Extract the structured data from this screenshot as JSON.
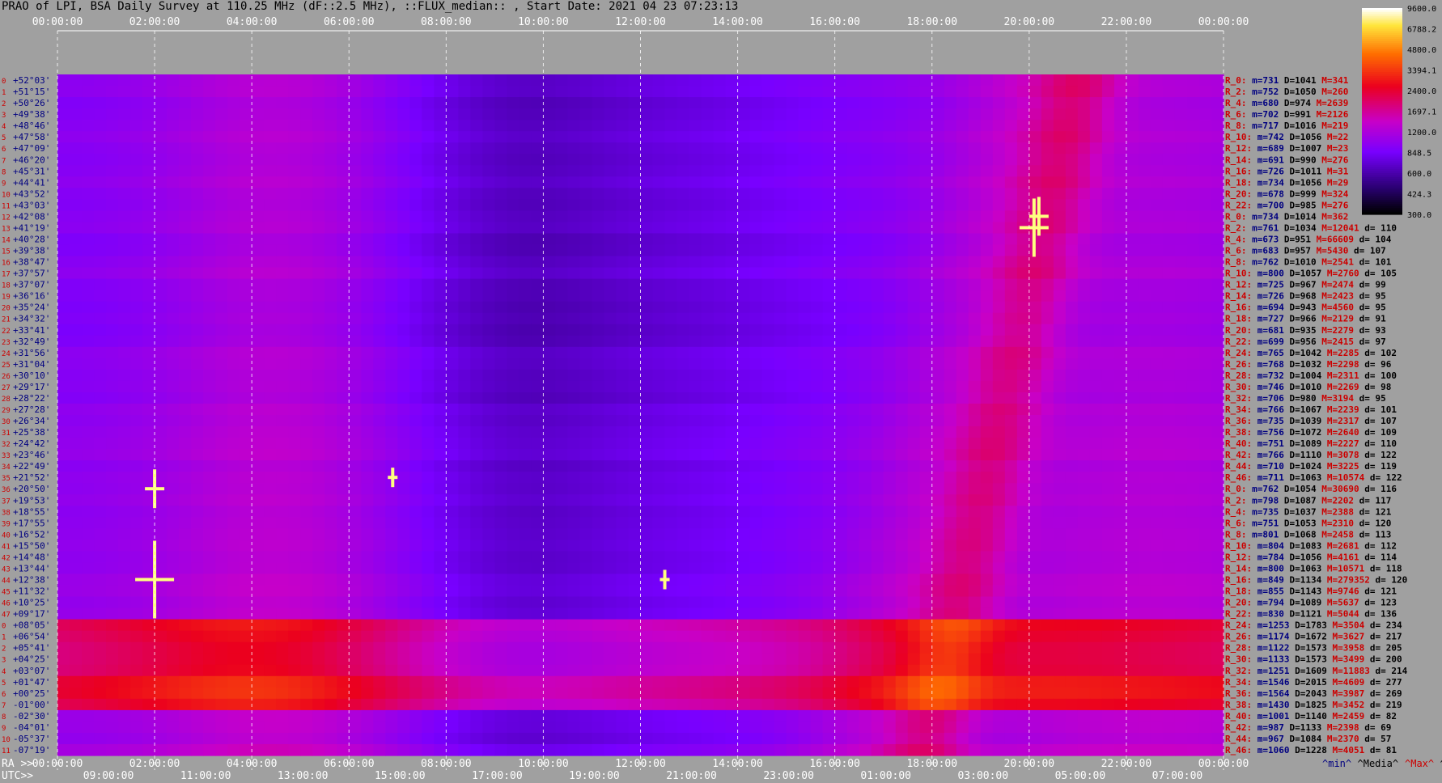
{
  "title": "PRAO of LPI, BSA Daily Survey at 110.25 MHz (dF::2.5 MHz), ::FLUX_median:: , Start Date: 2021 04 23 07:23:13",
  "colors": {
    "background": "#a0a0a0",
    "label_red": "#cc0000",
    "label_blue": "#000080",
    "axis_text": "#ffffff"
  },
  "chart_data": {
    "type": "heatmap",
    "title": "PRAO of LPI, BSA Daily Survey at 110.25 MHz (dF::2.5 MHz), ::FLUX_median:: , Start Date: 2021 04 23 07:23:13",
    "x_top_ticks": [
      "00:00:00",
      "02:00:00",
      "04:00:00",
      "06:00:00",
      "08:00:00",
      "10:00:00",
      "12:00:00",
      "14:00:00",
      "16:00:00",
      "18:00:00",
      "20:00:00",
      "22:00:00",
      "00:00:00"
    ],
    "x_ra_label": "RA >>",
    "x_ra_ticks": [
      "00:00:00",
      "02:00:00",
      "04:00:00",
      "06:00:00",
      "08:00:00",
      "10:00:00",
      "12:00:00",
      "14:00:00",
      "16:00:00",
      "18:00:00",
      "20:00:00",
      "22:00:00",
      "00:00:00"
    ],
    "x_utc_label": "UTC>>",
    "x_utc_ticks": [
      "09:00:00",
      "11:00:00",
      "13:00:00",
      "15:00:00",
      "17:00:00",
      "19:00:00",
      "21:00:00",
      "23:00:00",
      "01:00:00",
      "03:00:00",
      "05:00:00",
      "07:00:00"
    ],
    "y_labels": [
      "+52°03'",
      "+51°15'",
      "+50°26'",
      "+49°38'",
      "+48°46'",
      "+47°58'",
      "+47°09'",
      "+46°20'",
      "+45°31'",
      "+44°41'",
      "+43°52'",
      "+43°03'",
      "+42°08'",
      "+41°19'",
      "+40°28'",
      "+39°38'",
      "+38°47'",
      "+37°57'",
      "+37°07'",
      "+36°16'",
      "+35°24'",
      "+34°32'",
      "+33°41'",
      "+32°49'",
      "+31°56'",
      "+31°04'",
      "+30°10'",
      "+29°17'",
      "+28°22'",
      "+27°28'",
      "+26°34'",
      "+25°38'",
      "+24°42'",
      "+23°46'",
      "+22°49'",
      "+21°52'",
      "+20°50'",
      "+19°53'",
      "+18°55'",
      "+17°55'",
      "+16°52'",
      "+15°50'",
      "+14°48'",
      "+13°44'",
      "+12°38'",
      "+11°32'",
      "+10°25'",
      "+09°17'",
      "+08°05'",
      "+06°54'",
      "+05°41'",
      "+04°25'",
      "+03°07'",
      "+01°47'",
      "+00°25'",
      "-01°00'",
      "-02°30'",
      "-04°01'",
      "-05°37'",
      "-07°19'"
    ],
    "colorbar": {
      "ticks": [
        "9600.0",
        "6788.2",
        "4800.0",
        "3394.1",
        "2400.0",
        "1697.1",
        "1200.0",
        "848.5",
        "600.0",
        "424.3",
        "300.0"
      ],
      "range": [
        300,
        9600
      ],
      "scale": "log"
    },
    "beam_stats": [
      {
        "beam": "R_0:",
        "min": "m=731",
        "median": "D=1041",
        "max": "M=341",
        "devia": ""
      },
      {
        "beam": "R_2:",
        "min": "m=752",
        "median": "D=1050",
        "max": "M=260",
        "devia": ""
      },
      {
        "beam": "R_4:",
        "min": "m=680",
        "median": "D=974",
        "max": "M=2639",
        "devia": ""
      },
      {
        "beam": "R_6:",
        "min": "m=702",
        "median": "D=991",
        "max": "M=2126",
        "devia": ""
      },
      {
        "beam": "R_8:",
        "min": "m=717",
        "median": "D=1016",
        "max": "M=219",
        "devia": ""
      },
      {
        "beam": "R_10:",
        "min": "m=742",
        "median": "D=1056",
        "max": "M=22",
        "devia": ""
      },
      {
        "beam": "R_12:",
        "min": "m=689",
        "median": "D=1007",
        "max": "M=23",
        "devia": ""
      },
      {
        "beam": "R_14:",
        "min": "m=691",
        "median": "D=990",
        "max": "M=276",
        "devia": ""
      },
      {
        "beam": "R_16:",
        "min": "m=726",
        "median": "D=1011",
        "max": "M=31",
        "devia": ""
      },
      {
        "beam": "R_18:",
        "min": "m=734",
        "median": "D=1056",
        "max": "M=29",
        "devia": ""
      },
      {
        "beam": "R_20:",
        "min": "m=678",
        "median": "D=999",
        "max": "M=324",
        "devia": ""
      },
      {
        "beam": "R_22:",
        "min": "m=700",
        "median": "D=985",
        "max": "M=276",
        "devia": ""
      },
      {
        "beam": "R_0:",
        "min": "m=734",
        "median": "D=1014",
        "max": "M=362",
        "devia": ""
      },
      {
        "beam": "R_2:",
        "min": "m=761",
        "median": "D=1034",
        "max": "M=12041",
        "devia": "d= 110"
      },
      {
        "beam": "R_4:",
        "min": "m=673",
        "median": "D=951",
        "max": "M=66609",
        "devia": "d= 104"
      },
      {
        "beam": "R_6:",
        "min": "m=683",
        "median": "D=957",
        "max": "M=5430",
        "devia": "d= 107"
      },
      {
        "beam": "R_8:",
        "min": "m=762",
        "median": "D=1010",
        "max": "M=2541",
        "devia": "d= 101"
      },
      {
        "beam": "R_10:",
        "min": "m=800",
        "median": "D=1057",
        "max": "M=2760",
        "devia": "d= 105"
      },
      {
        "beam": "R_12:",
        "min": "m=725",
        "median": "D=967",
        "max": "M=2474",
        "devia": "d= 99"
      },
      {
        "beam": "R_14:",
        "min": "m=726",
        "median": "D=968",
        "max": "M=2423",
        "devia": "d= 95"
      },
      {
        "beam": "R_16:",
        "min": "m=694",
        "median": "D=943",
        "max": "M=4560",
        "devia": "d= 95"
      },
      {
        "beam": "R_18:",
        "min": "m=727",
        "median": "D=966",
        "max": "M=2129",
        "devia": "d= 91"
      },
      {
        "beam": "R_20:",
        "min": "m=681",
        "median": "D=935",
        "max": "M=2279",
        "devia": "d= 93"
      },
      {
        "beam": "R_22:",
        "min": "m=699",
        "median": "D=956",
        "max": "M=2415",
        "devia": "d= 97"
      },
      {
        "beam": "R_24:",
        "min": "m=765",
        "median": "D=1042",
        "max": "M=2285",
        "devia": "d= 102"
      },
      {
        "beam": "R_26:",
        "min": "m=768",
        "median": "D=1032",
        "max": "M=2298",
        "devia": "d= 96"
      },
      {
        "beam": "R_28:",
        "min": "m=732",
        "median": "D=1004",
        "max": "M=2311",
        "devia": "d= 100"
      },
      {
        "beam": "R_30:",
        "min": "m=746",
        "median": "D=1010",
        "max": "M=2269",
        "devia": "d= 98"
      },
      {
        "beam": "R_32:",
        "min": "m=706",
        "median": "D=980",
        "max": "M=3194",
        "devia": "d= 95"
      },
      {
        "beam": "R_34:",
        "min": "m=766",
        "median": "D=1067",
        "max": "M=2239",
        "devia": "d= 101"
      },
      {
        "beam": "R_36:",
        "min": "m=735",
        "median": "D=1039",
        "max": "M=2317",
        "devia": "d= 107"
      },
      {
        "beam": "R_38:",
        "min": "m=756",
        "median": "D=1072",
        "max": "M=2640",
        "devia": "d= 109"
      },
      {
        "beam": "R_40:",
        "min": "m=751",
        "median": "D=1089",
        "max": "M=2227",
        "devia": "d= 110"
      },
      {
        "beam": "R_42:",
        "min": "m=766",
        "median": "D=1110",
        "max": "M=3078",
        "devia": "d= 122"
      },
      {
        "beam": "R_44:",
        "min": "m=710",
        "median": "D=1024",
        "max": "M=3225",
        "devia": "d= 119"
      },
      {
        "beam": "R_46:",
        "min": "m=711",
        "median": "D=1063",
        "max": "M=10574",
        "devia": "d= 122"
      },
      {
        "beam": "R_0:",
        "min": "m=762",
        "median": "D=1054",
        "max": "M=30690",
        "devia": "d= 116"
      },
      {
        "beam": "R_2:",
        "min": "m=798",
        "median": "D=1087",
        "max": "M=2202",
        "devia": "d= 117"
      },
      {
        "beam": "R_4:",
        "min": "m=735",
        "median": "D=1037",
        "max": "M=2388",
        "devia": "d= 121"
      },
      {
        "beam": "R_6:",
        "min": "m=751",
        "median": "D=1053",
        "max": "M=2310",
        "devia": "d= 120"
      },
      {
        "beam": "R_8:",
        "min": "m=801",
        "median": "D=1068",
        "max": "M=2458",
        "devia": "d= 113"
      },
      {
        "beam": "R_10:",
        "min": "m=804",
        "median": "D=1083",
        "max": "M=2681",
        "devia": "d= 112"
      },
      {
        "beam": "R_12:",
        "min": "m=784",
        "median": "D=1056",
        "max": "M=4161",
        "devia": "d= 114"
      },
      {
        "beam": "R_14:",
        "min": "m=800",
        "median": "D=1063",
        "max": "M=10571",
        "devia": "d= 118"
      },
      {
        "beam": "R_16:",
        "min": "m=849",
        "median": "D=1134",
        "max": "M=279352",
        "devia": "d= 120"
      },
      {
        "beam": "R_18:",
        "min": "m=855",
        "median": "D=1143",
        "max": "M=9746",
        "devia": "d= 121"
      },
      {
        "beam": "R_20:",
        "min": "m=794",
        "median": "D=1089",
        "max": "M=5637",
        "devia": "d= 123"
      },
      {
        "beam": "R_22:",
        "min": "m=830",
        "median": "D=1121",
        "max": "M=5044",
        "devia": "d= 136"
      },
      {
        "beam": "R_24:",
        "min": "m=1253",
        "median": "D=1783",
        "max": "M=3504",
        "devia": "d= 234"
      },
      {
        "beam": "R_26:",
        "min": "m=1174",
        "median": "D=1672",
        "max": "M=3627",
        "devia": "d= 217"
      },
      {
        "beam": "R_28:",
        "min": "m=1122",
        "median": "D=1573",
        "max": "M=3958",
        "devia": "d= 205"
      },
      {
        "beam": "R_30:",
        "min": "m=1133",
        "median": "D=1573",
        "max": "M=3499",
        "devia": "d= 200"
      },
      {
        "beam": "R_32:",
        "min": "m=1251",
        "median": "D=1609",
        "max": "M=11883",
        "devia": "d= 214"
      },
      {
        "beam": "R_34:",
        "min": "m=1546",
        "median": "D=2015",
        "max": "M=4609",
        "devia": "d= 277"
      },
      {
        "beam": "R_36:",
        "min": "m=1564",
        "median": "D=2043",
        "max": "M=3987",
        "devia": "d= 269"
      },
      {
        "beam": "R_38:",
        "min": "m=1430",
        "median": "D=1825",
        "max": "M=3452",
        "devia": "d= 219"
      },
      {
        "beam": "R_40:",
        "min": "m=1001",
        "median": "D=1140",
        "max": "M=2459",
        "devia": "d= 82"
      },
      {
        "beam": "R_42:",
        "min": "m=987",
        "median": "D=1133",
        "max": "M=2398",
        "devia": "d= 69"
      },
      {
        "beam": "R_44:",
        "min": "m=967",
        "median": "D=1084",
        "max": "M=2370",
        "devia": "d= 57"
      },
      {
        "beam": "R_46:",
        "min": "m=1060",
        "median": "D=1228",
        "max": "M=4051",
        "devia": "d= 81"
      }
    ],
    "footer_legend": [
      "^min^",
      "^Media^",
      "^Max^",
      "^devia^"
    ]
  }
}
